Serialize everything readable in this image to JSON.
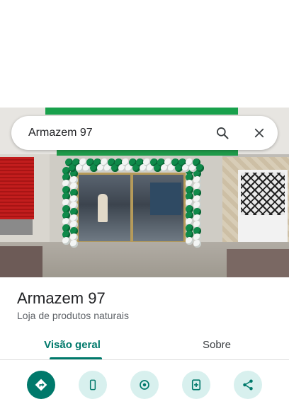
{
  "search": {
    "query": "Armazem 97"
  },
  "place": {
    "name": "Armazem 97",
    "category": "Loja de produtos naturais"
  },
  "tabs": [
    {
      "label": "Visão geral",
      "active": true
    },
    {
      "label": "Sobre",
      "active": false
    }
  ],
  "actions": [
    {
      "icon": "directions-icon",
      "primary": true
    },
    {
      "icon": "phone-icon",
      "primary": false
    },
    {
      "icon": "save-place-icon",
      "primary": false
    },
    {
      "icon": "add-photo-icon",
      "primary": false
    },
    {
      "icon": "share-icon",
      "primary": false
    }
  ],
  "colors": {
    "accent": "#00796b",
    "accent_light": "#d8f0ee",
    "balloon_green": "#0f8a4a",
    "balloon_white": "#f3f5f4"
  }
}
